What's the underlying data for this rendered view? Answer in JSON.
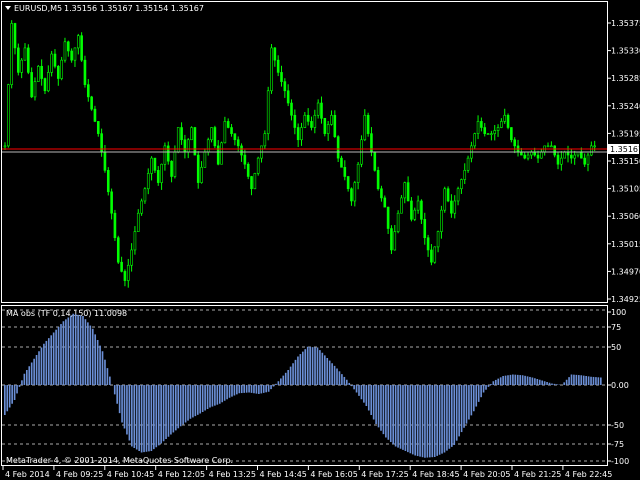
{
  "header": {
    "dropdown_icon": "triangle-down-icon",
    "symbol": "EURUSD,M5",
    "quotes": "1.35156 1.35167 1.35154 1.35167"
  },
  "main_chart": {
    "price_axis_labels": [
      "1.35375",
      "1.35330",
      "1.35285",
      "1.35240",
      "1.35195",
      "1.35150",
      "1.35105",
      "1.35060",
      "1.35015",
      "1.34970",
      "1.34925"
    ],
    "current_price": "1.35167",
    "colors": {
      "bull": "#00ff00",
      "bear": "#00ff00",
      "current_price_line": "#ff0000",
      "background": "#000000"
    }
  },
  "indicator": {
    "title": "MA obs (TF 0,14,150) 11.0098",
    "scale_labels": [
      "100",
      "75",
      "50",
      "0.00",
      "-50",
      "-75",
      "-100"
    ],
    "bar_color": "#6b8fd6"
  },
  "copyright": "MetaTrader 4, © 2001-2014, MetaQuotes Software Corp.",
  "time_axis_labels": [
    "4 Feb 2014",
    "4 Feb 09:25",
    "4 Feb 10:45",
    "4 Feb 12:05",
    "4 Feb 13:25",
    "4 Feb 14:45",
    "4 Feb 16:05",
    "4 Feb 17:25",
    "4 Feb 18:45",
    "4 Feb 20:05",
    "4 Feb 21:25",
    "4 Feb 22:45"
  ],
  "chart_data": [
    {
      "type": "candlestick",
      "title": "EURUSD,M5",
      "ylim": [
        1.34905,
        1.35395
      ],
      "close_approx": [
        1.3516,
        1.3536,
        1.3528,
        1.3532,
        1.3524,
        1.3529,
        1.3525,
        1.3531,
        1.3527,
        1.3533,
        1.353,
        1.3534,
        1.3526,
        1.3522,
        1.3518,
        1.3512,
        1.3505,
        1.3497,
        1.3494,
        1.3499,
        1.3505,
        1.3509,
        1.3514,
        1.351,
        1.3516,
        1.3511,
        1.3519,
        1.3515,
        1.3519,
        1.351,
        1.3515,
        1.3519,
        1.3513,
        1.352,
        1.3518,
        1.3516,
        1.3513,
        1.3509,
        1.3514,
        1.3518,
        1.3532,
        1.3528,
        1.3525,
        1.3521,
        1.3517,
        1.3521,
        1.3519,
        1.3523,
        1.3518,
        1.3521,
        1.3514,
        1.3511,
        1.3507,
        1.3513,
        1.3521,
        1.3515,
        1.3509,
        1.3506,
        1.3499,
        1.3505,
        1.351,
        1.3504,
        1.3507,
        1.3501,
        1.3497,
        1.3502,
        1.3509,
        1.3505,
        1.3509,
        1.3512,
        1.3516,
        1.352,
        1.3518,
        1.3518,
        1.3519,
        1.3521,
        1.3517,
        1.3515,
        1.3514,
        1.3515,
        1.3514,
        1.3516,
        1.3516,
        1.3513,
        1.3515,
        1.3514,
        1.3515,
        1.3513,
        1.3516,
        1.3516
      ]
    },
    {
      "type": "bar",
      "title": "MA obs (TF 0,14,150) 11.0098",
      "ylim": [
        -100,
        100
      ],
      "values_approx": [
        -40,
        -20,
        15,
        35,
        55,
        70,
        85,
        95,
        92,
        75,
        45,
        0,
        -50,
        -82,
        -90,
        -88,
        -78,
        -66,
        -55,
        -45,
        -38,
        -30,
        -25,
        -17,
        -11,
        -10,
        -12,
        -9,
        5,
        20,
        38,
        51,
        50,
        36,
        22,
        7,
        -10,
        -28,
        -52,
        -70,
        -82,
        -88,
        -94,
        -97,
        -96,
        -90,
        -80,
        -57,
        -35,
        -10,
        5,
        12,
        14,
        13,
        10,
        6,
        2,
        0,
        14,
        13,
        11,
        10
      ]
    }
  ]
}
